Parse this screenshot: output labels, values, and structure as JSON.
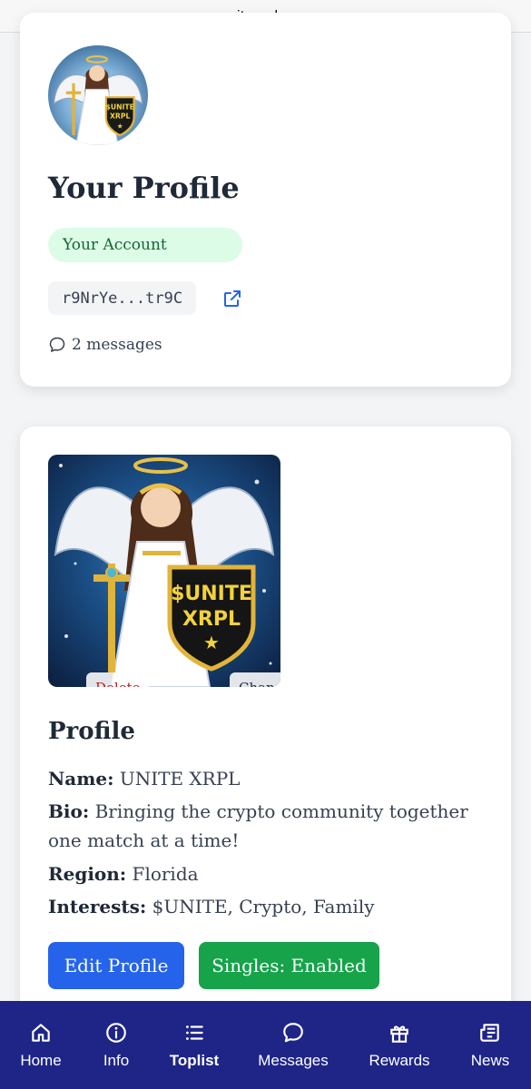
{
  "browser": {
    "url": "unitexrpl.com"
  },
  "profile_header": {
    "title": "Your Profile",
    "account_badge": "Your Account",
    "address": "r9NrYe...tr9C",
    "messages": "2 messages"
  },
  "profile_card": {
    "image_delete_label": "Delete",
    "image_change_label": "Change",
    "section_title": "Profile",
    "name_label": "Name:",
    "name_value": " UNITE XRPL",
    "bio_label": "Bio:",
    "bio_value": " Bringing the crypto community together one match at a time!",
    "region_label": "Region:",
    "region_value": " Florida",
    "interests_label": "Interests:",
    "interests_value": " $UNITE, Crypto, Family",
    "edit_button": "Edit Profile",
    "singles_button": "Singles: Enabled"
  },
  "bottom_nav": {
    "items": [
      {
        "label": "Home",
        "icon": "home-icon"
      },
      {
        "label": "Info",
        "icon": "info-icon"
      },
      {
        "label": "Toplist",
        "icon": "list-icon"
      },
      {
        "label": "Messages",
        "icon": "chat-icon"
      },
      {
        "label": "Rewards",
        "icon": "gift-icon"
      },
      {
        "label": "News",
        "icon": "newspaper-icon"
      }
    ],
    "active": "Toplist"
  },
  "colors": {
    "nav_bg": "#1e2587",
    "edit_button": "#2563eb",
    "singles_button": "#16a34a",
    "badge_bg": "#dcfce7",
    "badge_text": "#166534",
    "delete_text": "#b91c1c"
  },
  "logo_text": "$UNITE XRPL"
}
